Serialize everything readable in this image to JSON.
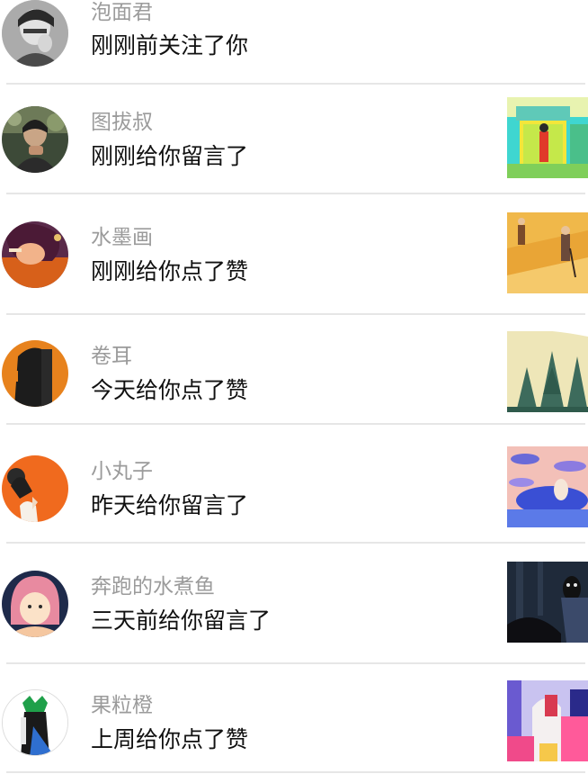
{
  "notifications": [
    {
      "user": "泡面君",
      "action": "刚刚前关注了你",
      "avatar_icon": "avatar-bw-portrait",
      "has_thumb": false
    },
    {
      "user": "图拔叔",
      "action": "刚刚给你留言了",
      "avatar_icon": "avatar-photo-person",
      "thumb_icon": "thumb-green-market-illustration"
    },
    {
      "user": "水墨画",
      "action": "刚刚给你点了赞",
      "avatar_icon": "avatar-illustrated-woman",
      "thumb_icon": "thumb-desert-travelers-illustration"
    },
    {
      "user": "卷耳",
      "action": "今天给你点了赞",
      "avatar_icon": "avatar-orange-black-abstract",
      "thumb_icon": "thumb-pine-forest-illustration"
    },
    {
      "user": "小丸子",
      "action": "昨天给你留言了",
      "avatar_icon": "avatar-orange-figure",
      "thumb_icon": "thumb-pink-blue-landscape-illustration"
    },
    {
      "user": "奔跑的水煮鱼",
      "action": "三天前给你留言了",
      "avatar_icon": "avatar-pink-hair-girl",
      "thumb_icon": "thumb-dark-night-forest-illustration"
    },
    {
      "user": "果粒橙",
      "action": "上周给你点了赞",
      "avatar_icon": "avatar-green-crown-figure",
      "thumb_icon": "thumb-colorful-architecture-illustration"
    }
  ],
  "colors": {
    "username": "#9b9b9b",
    "message": "#111111",
    "divider": "#e6e6e6"
  }
}
